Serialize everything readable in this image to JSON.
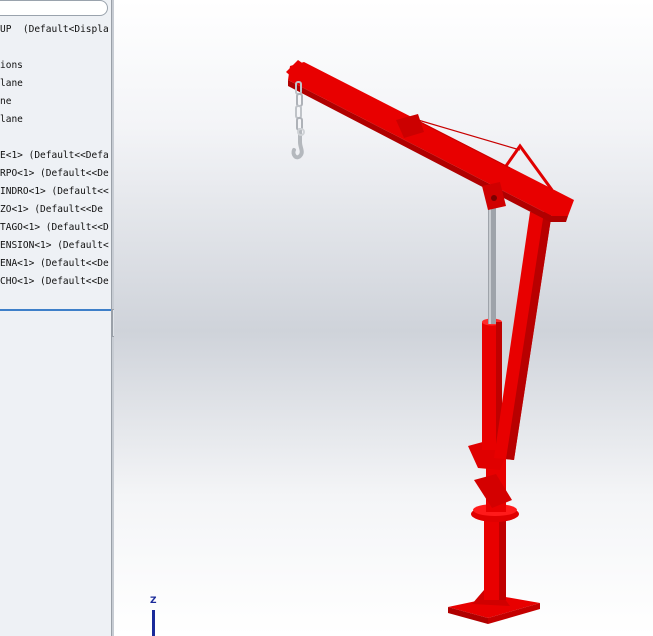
{
  "tree": {
    "filter_placeholder": "",
    "lines": [
      "UP  (Default<Displa",
      "",
      "ions",
      "lane",
      "ne",
      "lane",
      "",
      "E<1> (Default<<Defa",
      "RPO<1> (Default<<De",
      "INDRO<1> (Default<<",
      "ZO<1> (Default<<De",
      "TAGO<1> (Default<<D",
      "ENSION<1> (Default<",
      "ENA<1> (Default<<De",
      "CHO<1> (Default<<De"
    ]
  },
  "viewport": {
    "model": "crane-assembly",
    "colors": {
      "crane": "#e80000",
      "crane_dark": "#b00000",
      "piston": "#9ea3aa",
      "hook": "#cfd2d6",
      "background_top": "#ffffff",
      "background_mid": "#cfd3da"
    },
    "triad_axis_label": "Z"
  },
  "panel": {
    "collapse_glyph": "‹"
  }
}
